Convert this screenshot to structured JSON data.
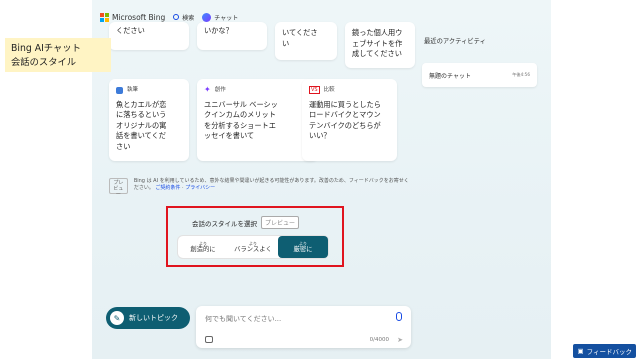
{
  "header": {
    "brand": "Microsoft Bing",
    "tabs": [
      {
        "label": "検索",
        "active": false
      },
      {
        "label": "チャット",
        "active": true
      }
    ],
    "brand_colors": [
      "#f25022",
      "#7fba00",
      "#00a4ef",
      "#ffb900"
    ]
  },
  "overlay_label": {
    "line1": "Bing AIチャット",
    "line2": "会話のスタイル"
  },
  "top_cards_partial": [
    {
      "text": "ください"
    },
    {
      "text": "いかな？"
    },
    {
      "text1": "いてくださ",
      "text2": "い"
    },
    {
      "text1": "鏡った個人用ウ",
      "text2": "ェブサイトを作",
      "text3": "成してください"
    }
  ],
  "cards": [
    {
      "category": "執筆",
      "icon": "writing-icon",
      "lines": [
        "魚とカエルが恋",
        "に落ちるという",
        "オリジナルの寓",
        "話を書いてくだ",
        "さい"
      ]
    },
    {
      "category": "創作",
      "icon": "sparkle-icon",
      "lines": [
        "ユニバーサル ベーシッ",
        "クインカムのメリット",
        "を分析するショートエ",
        "ッセイを書いて"
      ]
    },
    {
      "category": "比較",
      "icon": "compare-icon",
      "lines": [
        "運動用に買うとしたら",
        "ロードバイクとマウン",
        "テンバイクのどちらが",
        "いい？"
      ]
    }
  ],
  "notice": {
    "badge": "プレビュー",
    "text": "Bing は AI を利用しているため、意外な結果や間違いが起きる可能性があります。改善のため、フィードバックをお寄せください。",
    "link_terms": "ご契約条件",
    "link_privacy": "プライバシー"
  },
  "conversation_style": {
    "title": "会話のスタイルを選択",
    "badge": "プレビュー",
    "options": [
      {
        "prefix": "より",
        "label": "創造的に",
        "selected": false
      },
      {
        "prefix": "より",
        "label": "バランスよく",
        "selected": false
      },
      {
        "prefix": "より",
        "label": "厳密に",
        "selected": true
      }
    ]
  },
  "new_topic_label": "新しいトピック",
  "chat_input": {
    "placeholder": "何でも聞いてください...",
    "counter": "0/4000"
  },
  "recent": {
    "title": "最近のアクティビティ",
    "items": [
      {
        "title": "無題のチャット",
        "time": "午後4:56"
      }
    ]
  },
  "feedback_label": "フィードバック",
  "colors": {
    "accent": "#0e5e72",
    "link": "#174ae4",
    "highlight_border": "#e0141e",
    "overlay_bg": "#fff4c4"
  }
}
